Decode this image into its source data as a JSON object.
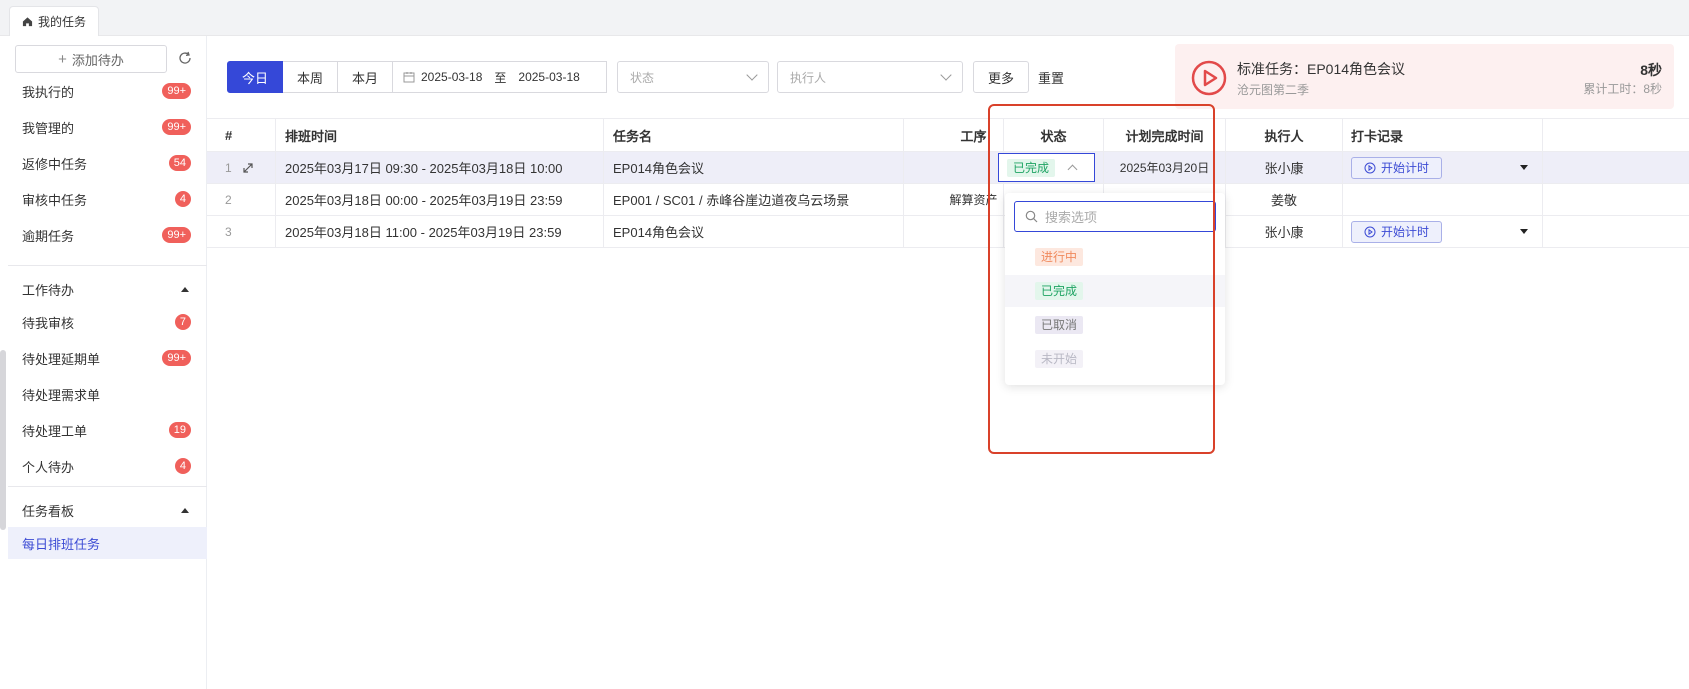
{
  "tab": {
    "label": "我的任务"
  },
  "sidebar": {
    "add_label": "添加待办",
    "items": [
      {
        "label": "我执行的",
        "badge": "99+"
      },
      {
        "label": "我管理的",
        "badge": "99+"
      },
      {
        "label": "返修中任务",
        "badge": "54"
      },
      {
        "label": "审核中任务",
        "badge": "4"
      },
      {
        "label": "逾期任务",
        "badge": "99+"
      }
    ],
    "groups": [
      {
        "label": "工作待办",
        "items": [
          {
            "label": "待我审核",
            "badge": "7"
          },
          {
            "label": "待处理延期单",
            "badge": "99+"
          },
          {
            "label": "待处理需求单",
            "badge": ""
          },
          {
            "label": "待处理工单",
            "badge": "19"
          },
          {
            "label": "个人待办",
            "badge": "4"
          }
        ]
      },
      {
        "label": "任务看板",
        "items": [
          {
            "label": "每日排班任务",
            "badge": ""
          }
        ]
      }
    ]
  },
  "filters": {
    "periods": [
      "今日",
      "本周",
      "本月"
    ],
    "date_start": "2025-03-18",
    "date_sep": "至",
    "date_end": "2025-03-18",
    "status_placeholder": "状态",
    "executor_placeholder": "执行人",
    "more_label": "更多",
    "reset_label": "重置"
  },
  "timer": {
    "title": "标准任务：EP014角色会议",
    "subtitle": "沧元图第二季",
    "seconds": "8秒",
    "total": "累计工时：8秒"
  },
  "table": {
    "headers": [
      "#",
      "排班时间",
      "任务名",
      "工序",
      "状态",
      "计划完成时间",
      "执行人",
      "打卡记录"
    ],
    "rows": [
      {
        "num": "1",
        "time": "2025年03月17日 09:30 - 2025年03月18日 10:00",
        "name": "EP014角色会议",
        "process": "",
        "status": "已完成",
        "due": "2025年03月20日",
        "executor": "张小康",
        "punch": "开始计时"
      },
      {
        "num": "2",
        "time": "2025年03月18日 00:00 - 2025年03月19日 23:59",
        "name": "EP001 / SC01 / 赤峰谷崖边道夜乌云场景",
        "process": "解算资产",
        "status": "",
        "due": "",
        "executor": "姜敬",
        "punch": ""
      },
      {
        "num": "3",
        "time": "2025年03月18日 11:00 - 2025年03月19日 23:59",
        "name": "EP014角色会议",
        "process": "",
        "status": "",
        "due": "",
        "executor": "张小康",
        "punch": "开始计时"
      }
    ]
  },
  "dropdown": {
    "search_placeholder": "搜索选项",
    "options": [
      "进行中",
      "已完成",
      "已取消",
      "未开始"
    ],
    "selected": "已完成"
  },
  "colors": {
    "primary": "#3548d8",
    "badge": "#f0605b",
    "highlight_box": "#d9412a"
  }
}
